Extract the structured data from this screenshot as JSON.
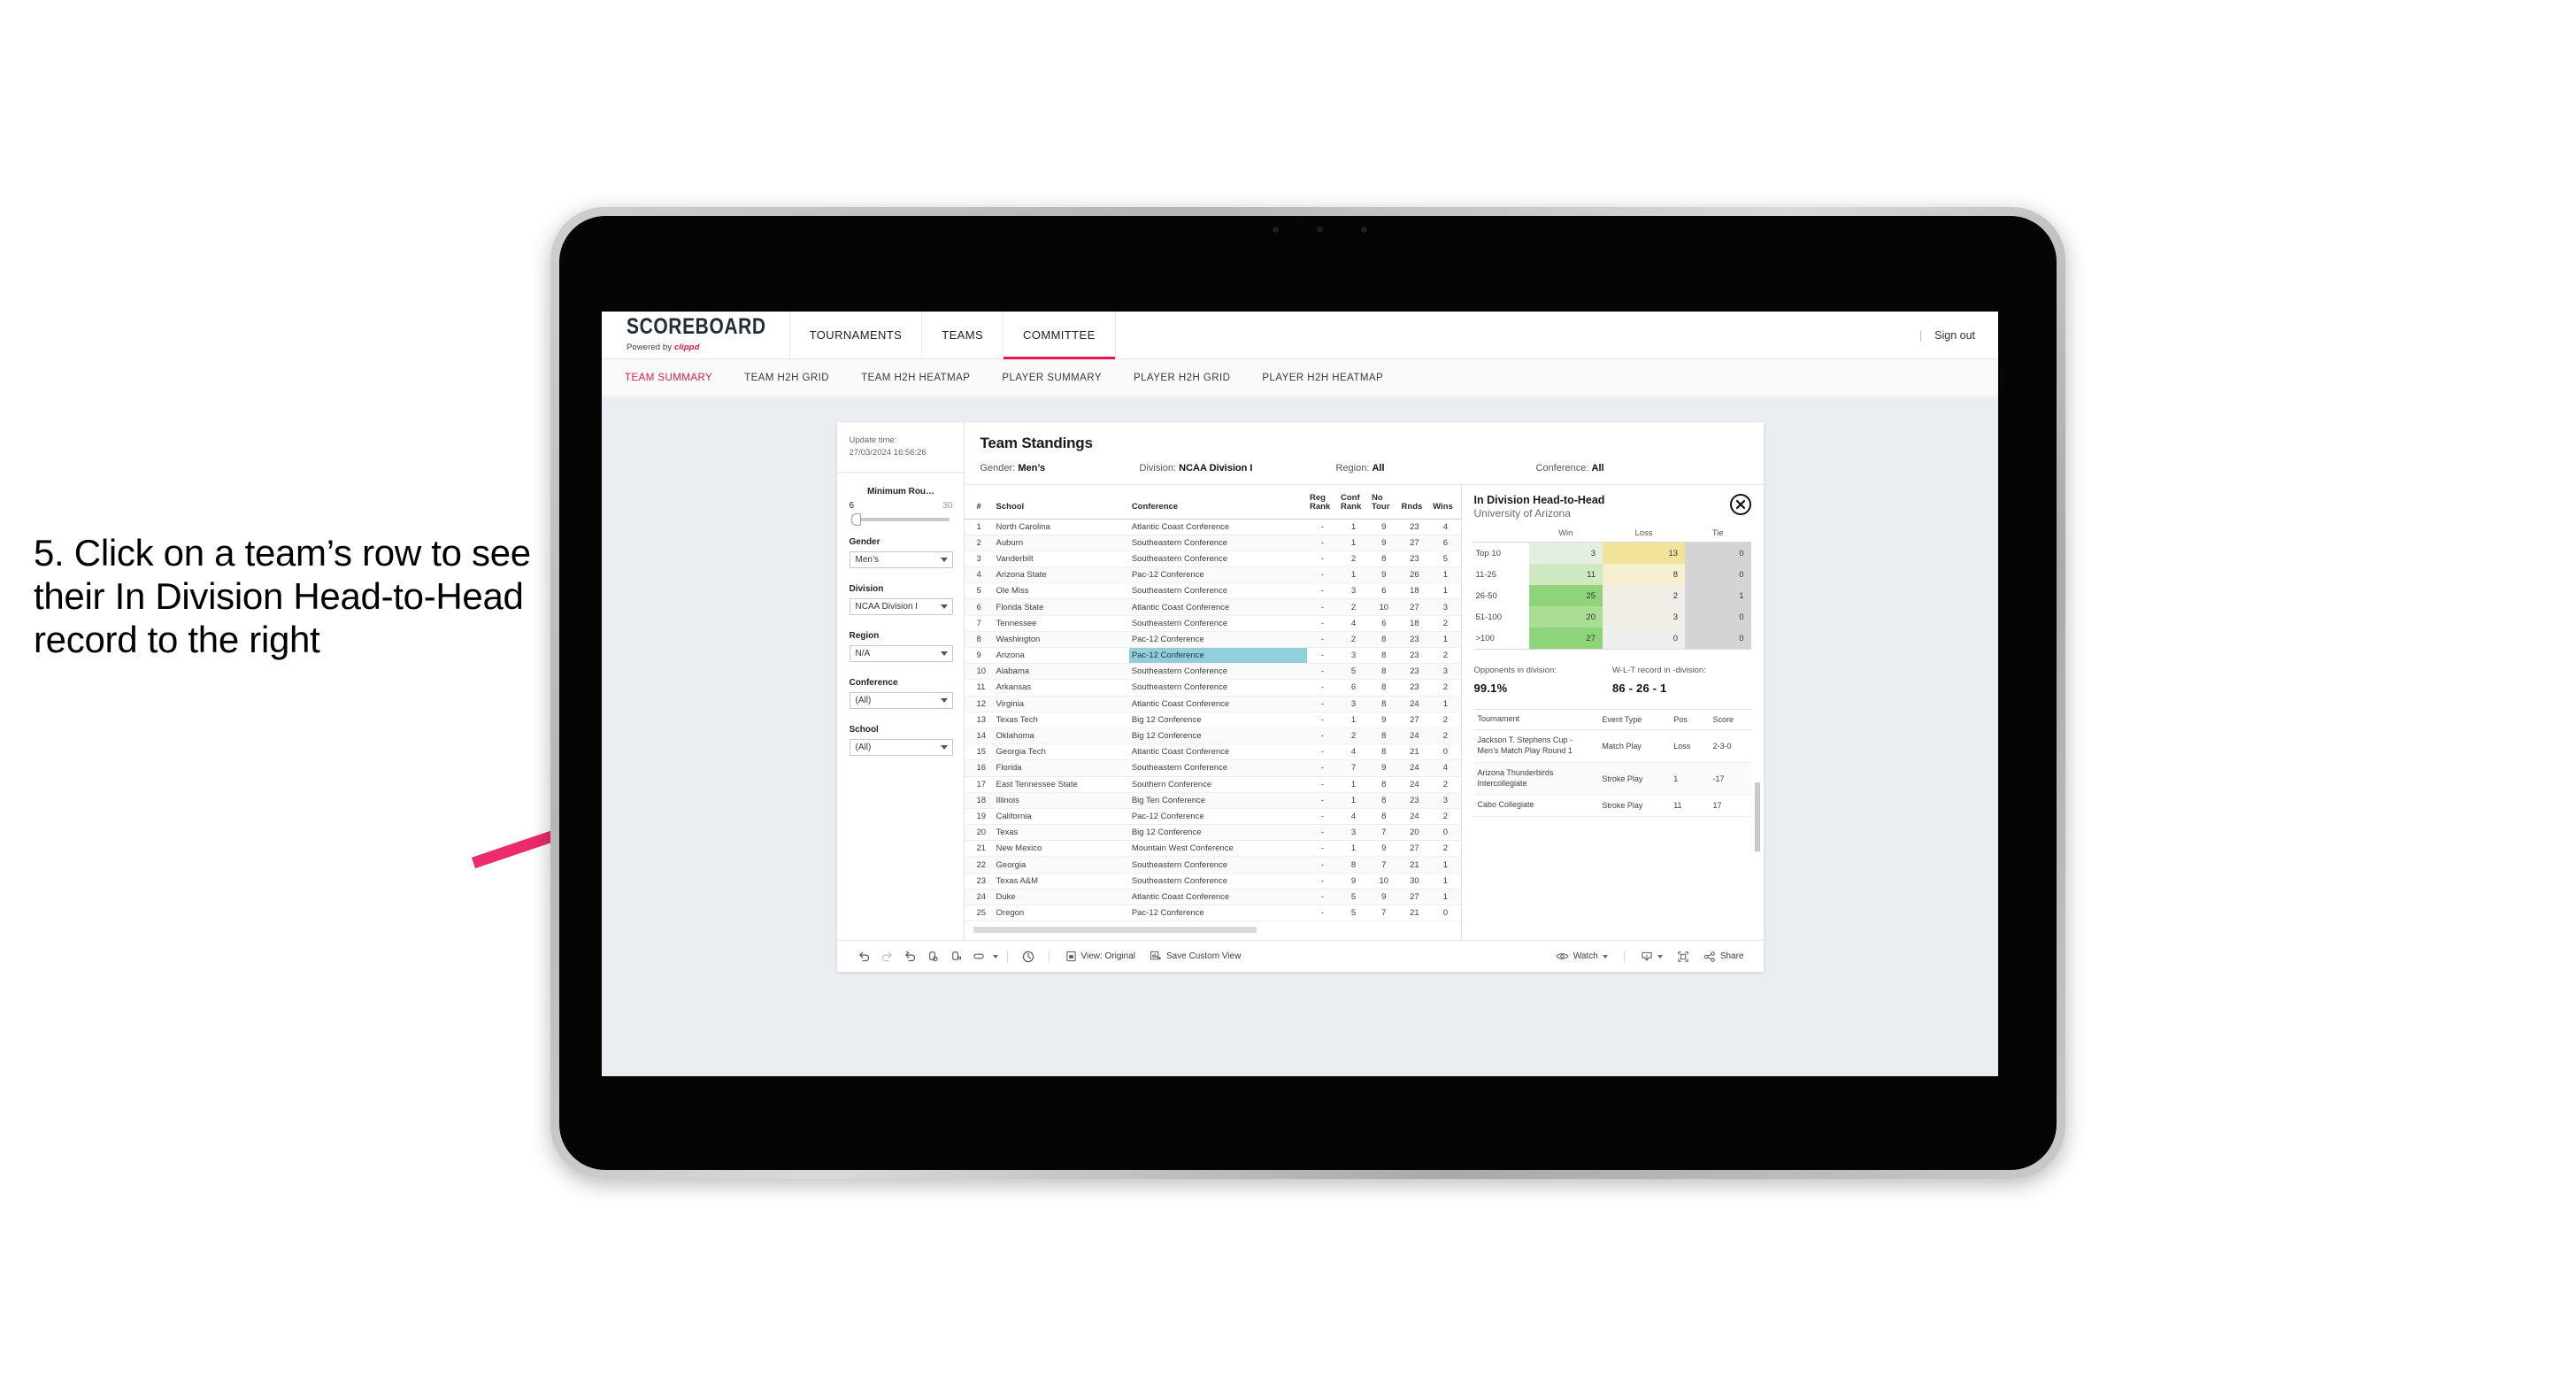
{
  "instruction": {
    "text": "5. Click on a team’s row to see their In Division Head-to-Head record to the right",
    "arrow_color": "#ee2a6c"
  },
  "topnav": {
    "brand": "SCOREBOARD",
    "brand_sub_prefix": "Powered by ",
    "brand_sub_name": "clippd",
    "items": [
      {
        "label": "TOURNAMENTS",
        "active": false
      },
      {
        "label": "TEAMS",
        "active": false
      },
      {
        "label": "COMMITTEE",
        "active": true
      }
    ],
    "sign_out": "Sign out",
    "separator": "|",
    "accent": "#e8174a"
  },
  "subnav": {
    "items": [
      {
        "label": "TEAM SUMMARY",
        "active": true
      },
      {
        "label": "TEAM H2H GRID",
        "active": false
      },
      {
        "label": "TEAM H2H HEATMAP",
        "active": false
      },
      {
        "label": "PLAYER SUMMARY",
        "active": false
      },
      {
        "label": "PLAYER H2H GRID",
        "active": false
      },
      {
        "label": "PLAYER H2H HEATMAP",
        "active": false
      }
    ]
  },
  "filters": {
    "update_time_label": "Update time:",
    "update_time_value": "27/03/2024 16:56:26",
    "min_rounds": {
      "title": "Minimum Rou…",
      "min": "6",
      "max": "30"
    },
    "groups": [
      {
        "title": "Gender",
        "value": "Men’s"
      },
      {
        "title": "Division",
        "value": "NCAA Division I"
      },
      {
        "title": "Region",
        "value": "N/A"
      },
      {
        "title": "Conference",
        "value": "(All)"
      },
      {
        "title": "School",
        "value": "(All)"
      }
    ]
  },
  "standings": {
    "title": "Team Standings",
    "meta": [
      {
        "label": "Gender:",
        "value": "Men’s"
      },
      {
        "label": "Division:",
        "value": "NCAA Division I"
      },
      {
        "label": "Region:",
        "value": "All"
      },
      {
        "label": "Conference:",
        "value": "All"
      }
    ],
    "columns": [
      "#",
      "School",
      "Conference",
      "Reg Rank",
      "Conf Rank",
      "No Tour",
      "Rnds",
      "Wins"
    ],
    "selected_row_index": 8,
    "rows": [
      {
        "num": "1",
        "school": "North Carolina",
        "conference": "Atlantic Coast Conference",
        "reg_rank": "-",
        "conf_rank": "1",
        "no_tour": "9",
        "rnds": "23",
        "wins": "4"
      },
      {
        "num": "2",
        "school": "Auburn",
        "conference": "Southeastern Conference",
        "reg_rank": "-",
        "conf_rank": "1",
        "no_tour": "9",
        "rnds": "27",
        "wins": "6"
      },
      {
        "num": "3",
        "school": "Vanderbilt",
        "conference": "Southeastern Conference",
        "reg_rank": "-",
        "conf_rank": "2",
        "no_tour": "8",
        "rnds": "23",
        "wins": "5"
      },
      {
        "num": "4",
        "school": "Arizona State",
        "conference": "Pac-12 Conference",
        "reg_rank": "-",
        "conf_rank": "1",
        "no_tour": "9",
        "rnds": "26",
        "wins": "1"
      },
      {
        "num": "5",
        "school": "Ole Miss",
        "conference": "Southeastern Conference",
        "reg_rank": "-",
        "conf_rank": "3",
        "no_tour": "6",
        "rnds": "18",
        "wins": "1"
      },
      {
        "num": "6",
        "school": "Florida State",
        "conference": "Atlantic Coast Conference",
        "reg_rank": "-",
        "conf_rank": "2",
        "no_tour": "10",
        "rnds": "27",
        "wins": "3"
      },
      {
        "num": "7",
        "school": "Tennessee",
        "conference": "Southeastern Conference",
        "reg_rank": "-",
        "conf_rank": "4",
        "no_tour": "6",
        "rnds": "18",
        "wins": "2"
      },
      {
        "num": "8",
        "school": "Washington",
        "conference": "Pac-12 Conference",
        "reg_rank": "-",
        "conf_rank": "2",
        "no_tour": "8",
        "rnds": "23",
        "wins": "1"
      },
      {
        "num": "9",
        "school": "Arizona",
        "conference": "Pac-12 Conference",
        "reg_rank": "-",
        "conf_rank": "3",
        "no_tour": "8",
        "rnds": "23",
        "wins": "2"
      },
      {
        "num": "10",
        "school": "Alabama",
        "conference": "Southeastern Conference",
        "reg_rank": "-",
        "conf_rank": "5",
        "no_tour": "8",
        "rnds": "23",
        "wins": "3"
      },
      {
        "num": "11",
        "school": "Arkansas",
        "conference": "Southeastern Conference",
        "reg_rank": "-",
        "conf_rank": "6",
        "no_tour": "8",
        "rnds": "23",
        "wins": "2"
      },
      {
        "num": "12",
        "school": "Virginia",
        "conference": "Atlantic Coast Conference",
        "reg_rank": "-",
        "conf_rank": "3",
        "no_tour": "8",
        "rnds": "24",
        "wins": "1"
      },
      {
        "num": "13",
        "school": "Texas Tech",
        "conference": "Big 12 Conference",
        "reg_rank": "-",
        "conf_rank": "1",
        "no_tour": "9",
        "rnds": "27",
        "wins": "2"
      },
      {
        "num": "14",
        "school": "Oklahoma",
        "conference": "Big 12 Conference",
        "reg_rank": "-",
        "conf_rank": "2",
        "no_tour": "8",
        "rnds": "24",
        "wins": "2"
      },
      {
        "num": "15",
        "school": "Georgia Tech",
        "conference": "Atlantic Coast Conference",
        "reg_rank": "-",
        "conf_rank": "4",
        "no_tour": "8",
        "rnds": "21",
        "wins": "0"
      },
      {
        "num": "16",
        "school": "Florida",
        "conference": "Southeastern Conference",
        "reg_rank": "-",
        "conf_rank": "7",
        "no_tour": "9",
        "rnds": "24",
        "wins": "4"
      },
      {
        "num": "17",
        "school": "East Tennessee State",
        "conference": "Southern Conference",
        "reg_rank": "-",
        "conf_rank": "1",
        "no_tour": "8",
        "rnds": "24",
        "wins": "2"
      },
      {
        "num": "18",
        "school": "Illinois",
        "conference": "Big Ten Conference",
        "reg_rank": "-",
        "conf_rank": "1",
        "no_tour": "8",
        "rnds": "23",
        "wins": "3"
      },
      {
        "num": "19",
        "school": "California",
        "conference": "Pac-12 Conference",
        "reg_rank": "-",
        "conf_rank": "4",
        "no_tour": "8",
        "rnds": "24",
        "wins": "2"
      },
      {
        "num": "20",
        "school": "Texas",
        "conference": "Big 12 Conference",
        "reg_rank": "-",
        "conf_rank": "3",
        "no_tour": "7",
        "rnds": "20",
        "wins": "0"
      },
      {
        "num": "21",
        "school": "New Mexico",
        "conference": "Mountain West Conference",
        "reg_rank": "-",
        "conf_rank": "1",
        "no_tour": "9",
        "rnds": "27",
        "wins": "2"
      },
      {
        "num": "22",
        "school": "Georgia",
        "conference": "Southeastern Conference",
        "reg_rank": "-",
        "conf_rank": "8",
        "no_tour": "7",
        "rnds": "21",
        "wins": "1"
      },
      {
        "num": "23",
        "school": "Texas A&M",
        "conference": "Southeastern Conference",
        "reg_rank": "-",
        "conf_rank": "9",
        "no_tour": "10",
        "rnds": "30",
        "wins": "1"
      },
      {
        "num": "24",
        "school": "Duke",
        "conference": "Atlantic Coast Conference",
        "reg_rank": "-",
        "conf_rank": "5",
        "no_tour": "9",
        "rnds": "27",
        "wins": "1"
      },
      {
        "num": "25",
        "school": "Oregon",
        "conference": "Pac-12 Conference",
        "reg_rank": "-",
        "conf_rank": "5",
        "no_tour": "7",
        "rnds": "21",
        "wins": "0"
      }
    ]
  },
  "h2h": {
    "title": "In Division Head-to-Head",
    "subtitle": "University of Arizona",
    "close_icon": "close-icon",
    "columns": [
      "",
      "Win",
      "Loss",
      "Tie"
    ],
    "rows": [
      {
        "label": "Top 10",
        "win": "3",
        "loss": "13",
        "tie": "0",
        "win_color": "#e4efe2",
        "loss_color": "#f2e39a",
        "tie_color": "#d4d4d4"
      },
      {
        "label": "11-25",
        "win": "11",
        "loss": "8",
        "tie": "0",
        "win_color": "#cfe9c2",
        "loss_color": "#f6efd0",
        "tie_color": "#d4d4d4"
      },
      {
        "label": "26-50",
        "win": "25",
        "loss": "2",
        "tie": "1",
        "win_color": "#8ed47a",
        "loss_color": "#f0eee7",
        "tie_color": "#d4d4d4"
      },
      {
        "label": "51-100",
        "win": "20",
        "loss": "3",
        "tie": "0",
        "win_color": "#aadd94",
        "loss_color": "#f1eee6",
        "tie_color": "#d4d4d4"
      },
      {
        "label": ">100",
        "win": "27",
        "loss": "0",
        "tie": "0",
        "win_color": "#8ed47a",
        "loss_color": "#eeeeec",
        "tie_color": "#d4d4d4"
      }
    ],
    "kpis": [
      {
        "label": "Opponents in division:",
        "value": "99.1%"
      },
      {
        "label": "W-L-T record in -division:",
        "value": "86 - 26 - 1"
      }
    ],
    "tournaments": {
      "columns": [
        "Tournament",
        "Event Type",
        "Pos",
        "Score"
      ],
      "rows": [
        {
          "name": "Jackson T. Stephens Cup - Men’s Match Play Round 1",
          "type": "Match Play",
          "pos": "Loss",
          "score": "2-3-0"
        },
        {
          "name": "Arizona Thunderbirds Intercollegiate",
          "type": "Stroke Play",
          "pos": "1",
          "score": "-17"
        },
        {
          "name": "Cabo Collegiate",
          "type": "Stroke Play",
          "pos": "11",
          "score": "17"
        }
      ]
    }
  },
  "toolbar": {
    "icons": [
      "undo-icon",
      "redo-icon",
      "revert-icon",
      "refresh-data-icon",
      "pause-updates-icon",
      "device-layout-icon"
    ],
    "view_label": "View: Original",
    "save_label": "Save Custom View",
    "watch_label": "Watch",
    "share_label": "Share",
    "download_icon": "download-icon",
    "fullscreen_icon": "fullscreen-icon",
    "alert_icon": "alert-icon"
  }
}
